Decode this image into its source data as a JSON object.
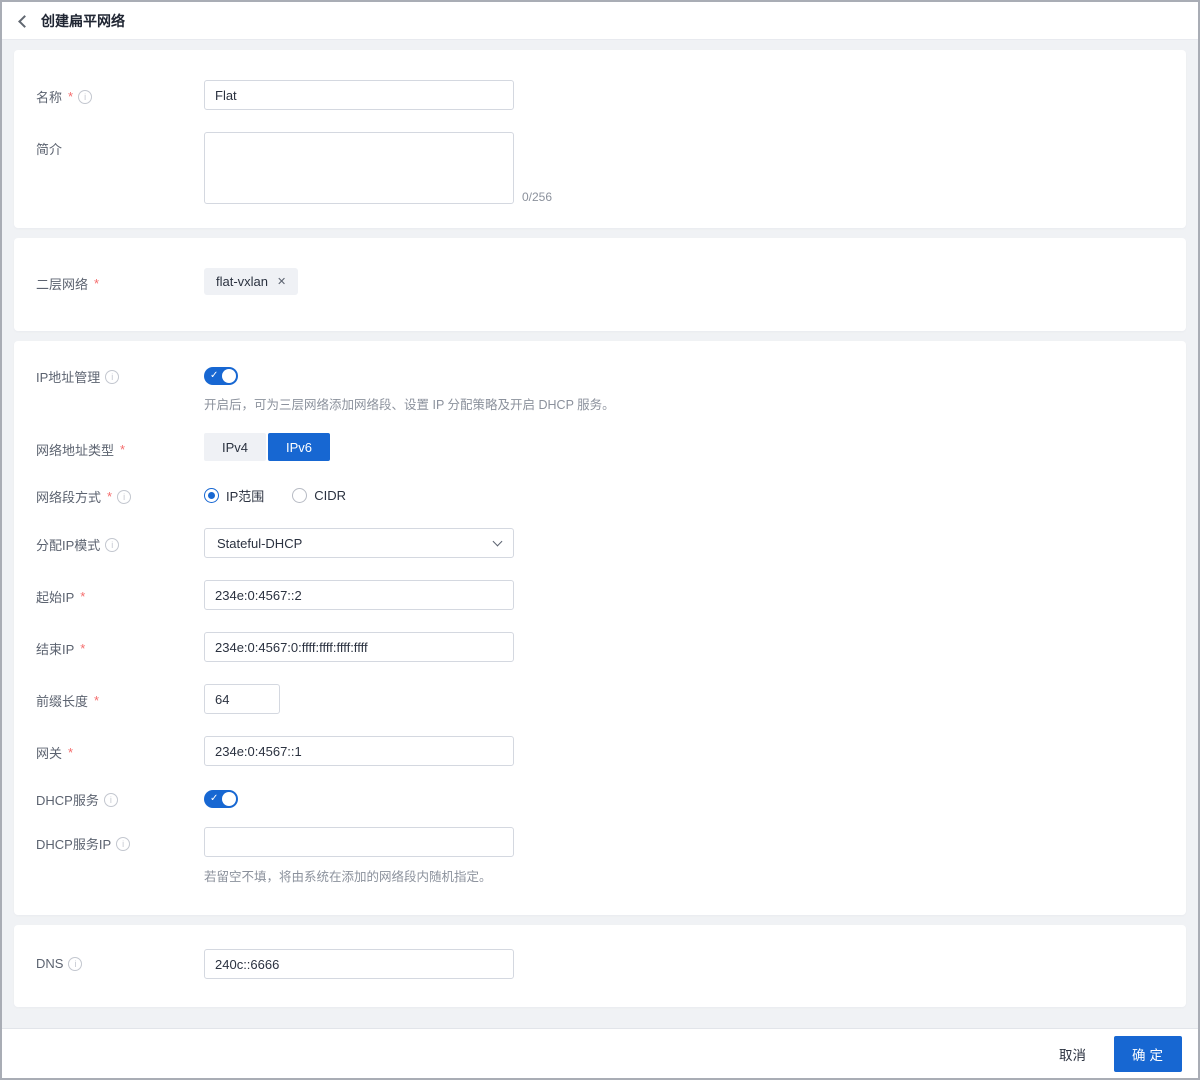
{
  "colors": {
    "primary": "#1767d2",
    "required": "#f56c6c",
    "page_bg": "#f0f2f5",
    "card_bg": "#ffffff",
    "label_text": "#5c6370",
    "hint_text": "#8b919c"
  },
  "icons": {
    "back": "back-chevron",
    "info": "i",
    "check": "✓",
    "close": "✕"
  },
  "header": {
    "title": "创建扁平网络"
  },
  "form": {
    "name": {
      "label": "名称",
      "value": "Flat"
    },
    "description": {
      "label": "简介",
      "value": "",
      "counter": "0/256"
    },
    "l2network": {
      "label": "二层网络",
      "tag": "flat-vxlan"
    },
    "ip_mgmt": {
      "label": "IP地址管理",
      "enabled": true,
      "hint": "开启后，可为三层网络添加网络段、设置 IP 分配策略及开启 DHCP 服务。"
    },
    "addr_type": {
      "label": "网络地址类型",
      "options": [
        "IPv4",
        "IPv6"
      ],
      "selected": "IPv6"
    },
    "segment_mode": {
      "label": "网络段方式",
      "options": [
        "IP范围",
        "CIDR"
      ],
      "selected": "IP范围"
    },
    "alloc_mode": {
      "label": "分配IP模式",
      "value": "Stateful-DHCP"
    },
    "start_ip": {
      "label": "起始IP",
      "value": "234e:0:4567::2"
    },
    "end_ip": {
      "label": "结束IP",
      "value": "234e:0:4567:0:ffff:ffff:ffff:ffff"
    },
    "prefix_len": {
      "label": "前缀长度",
      "value": "64"
    },
    "gateway": {
      "label": "网关",
      "value": "234e:0:4567::1"
    },
    "dhcp": {
      "label": "DHCP服务",
      "enabled": true
    },
    "dhcp_ip": {
      "label": "DHCP服务IP",
      "value": "",
      "hint": "若留空不填，将由系统在添加的网络段内随机指定。"
    },
    "dns": {
      "label": "DNS",
      "value": "240c::6666"
    }
  },
  "footer": {
    "cancel": "取消",
    "confirm": "确定"
  }
}
